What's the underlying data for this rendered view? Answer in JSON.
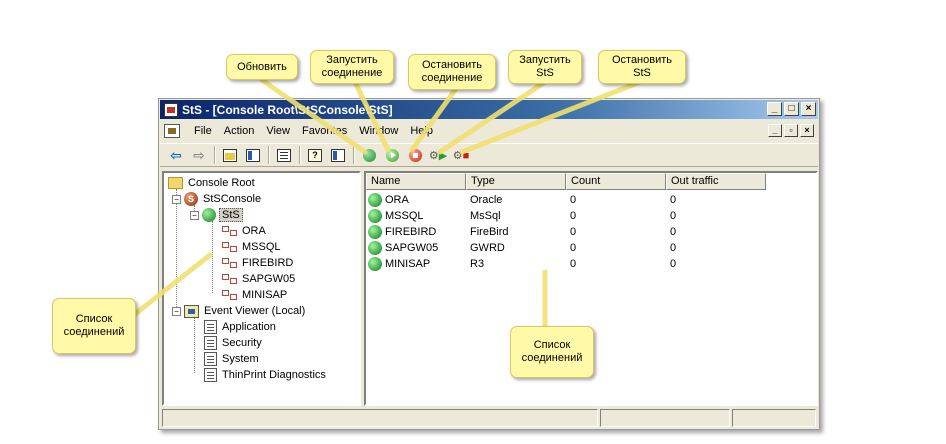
{
  "window": {
    "title": "StS - [Console Root\\StSConsole\\StS]",
    "controls": {
      "minimize": "_",
      "maximize": "□",
      "close": "×"
    },
    "mdi_controls": {
      "minimize": "_",
      "restore": "▫",
      "close": "×"
    }
  },
  "menu": [
    "File",
    "Action",
    "View",
    "Favorites",
    "Window",
    "Help"
  ],
  "toolbar": {
    "buttons": [
      "back-arrow-icon",
      "forward-arrow-icon",
      "up-folder-icon",
      "show-hide-tree-icon",
      "export-list-icon",
      "help-icon",
      "properties-pane-icon",
      "refresh-icon",
      "start-connection-icon",
      "stop-connection-icon",
      "start-sts-icon",
      "stop-sts-icon"
    ]
  },
  "tree": {
    "root": "Console Root",
    "sts_console": "StSConsole",
    "sts": "StS",
    "connections": [
      "ORA",
      "MSSQL",
      "FIREBIRD",
      "SAPGW05",
      "MINISAP"
    ],
    "event_viewer": "Event Viewer (Local)",
    "logs": [
      "Application",
      "Security",
      "System",
      "ThinPrint Diagnostics"
    ]
  },
  "list": {
    "columns": [
      "Name",
      "Type",
      "Count",
      "Out traffic"
    ],
    "rows": [
      {
        "name": "ORA",
        "type": "Oracle",
        "count": "0",
        "out": "0"
      },
      {
        "name": "MSSQL",
        "type": "MsSql",
        "count": "0",
        "out": "0"
      },
      {
        "name": "FIREBIRD",
        "type": "FireBird",
        "count": "0",
        "out": "0"
      },
      {
        "name": "SAPGW05",
        "type": "GWRD",
        "count": "0",
        "out": "0"
      },
      {
        "name": "MINISAP",
        "type": "R3",
        "count": "0",
        "out": "0"
      }
    ]
  },
  "callouts": {
    "refresh": "Обновить",
    "start_conn": "Запустить соединение",
    "stop_conn": "Остановить соединение",
    "start_sts": "Запустить StS",
    "stop_sts": "Остановить StS",
    "tree_list": "Список соединений",
    "right_list": "Список соединений"
  },
  "colors": {
    "callout_bg": "#fff9a8",
    "title_bar": "#0a246a",
    "window_bg": "#ece9d8"
  }
}
